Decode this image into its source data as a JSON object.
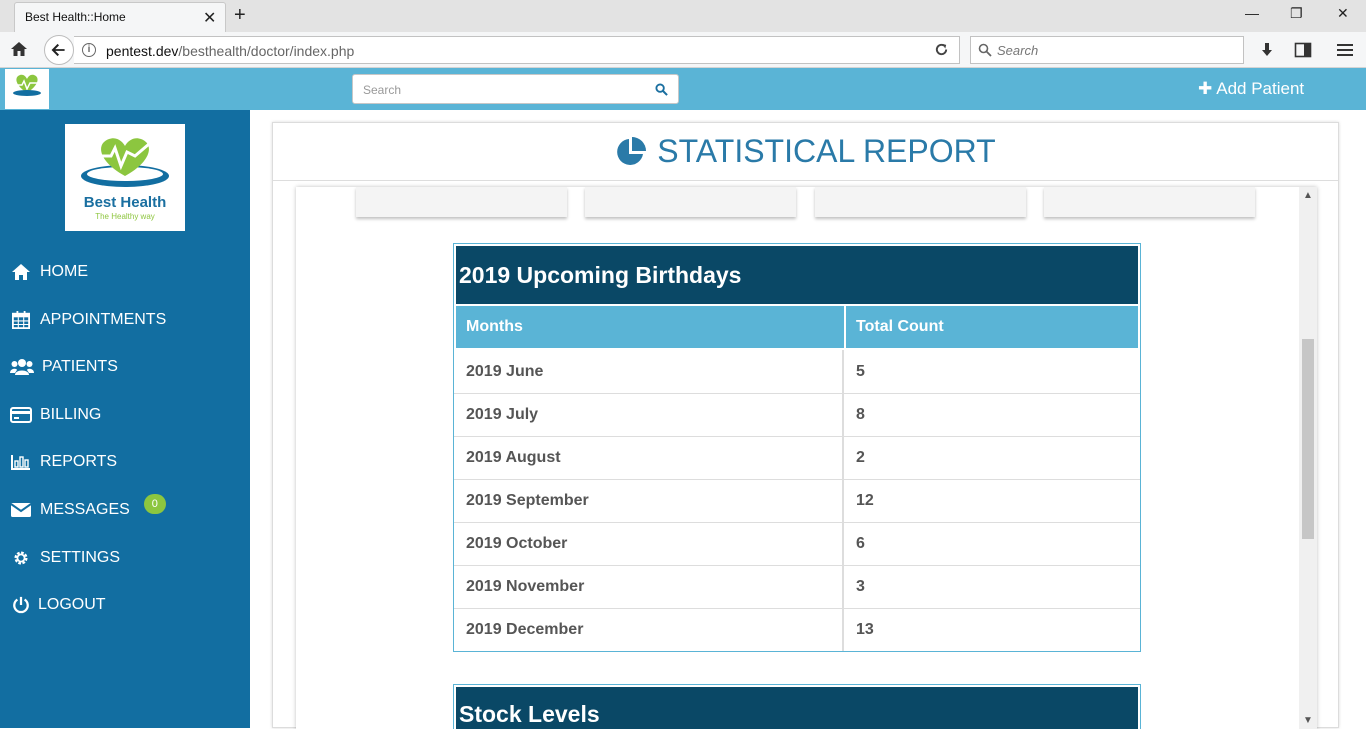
{
  "browser": {
    "tab_title": "Best Health::Home",
    "tab_close": "✕",
    "new_tab": "+",
    "url_host": "pentest.dev",
    "url_path": "/besthealth/doctor/index.php",
    "search_placeholder": "Search",
    "minimize": "—",
    "restore": "❐",
    "close": "✕"
  },
  "header": {
    "search_placeholder": "Search",
    "add_patient_label": "Add Patient"
  },
  "brand": {
    "name": "Best Health",
    "tagline": "The Healthy way"
  },
  "sidebar": {
    "items": [
      {
        "label": "HOME",
        "icon": "home-icon"
      },
      {
        "label": "APPOINTMENTS",
        "icon": "calendar-icon"
      },
      {
        "label": "PATIENTS",
        "icon": "users-icon"
      },
      {
        "label": "BILLING",
        "icon": "credit-card-icon"
      },
      {
        "label": "REPORTS",
        "icon": "bar-chart-icon"
      },
      {
        "label": "MESSAGES",
        "icon": "envelope-icon",
        "badge": "0"
      },
      {
        "label": "SETTINGS",
        "icon": "gear-icon"
      },
      {
        "label": "LOGOUT",
        "icon": "power-icon"
      }
    ]
  },
  "report": {
    "title": "STATISTICAL REPORT",
    "birthdays": {
      "title": "2019 Upcoming Birthdays",
      "col_months": "Months",
      "col_count": "Total Count",
      "rows": [
        {
          "month": "2019 June",
          "count": "5"
        },
        {
          "month": "2019 July",
          "count": "8"
        },
        {
          "month": "2019 August",
          "count": "2"
        },
        {
          "month": "2019 September",
          "count": "12"
        },
        {
          "month": "2019 October",
          "count": "6"
        },
        {
          "month": "2019 November",
          "count": "3"
        },
        {
          "month": "2019 December",
          "count": "13"
        }
      ]
    },
    "stock_title": "Stock Levels"
  },
  "colors": {
    "sidebar": "#126ea1",
    "header": "#5ab4d6",
    "table_title": "#0a4866",
    "badge": "#8cc63f",
    "title": "#2a7aa8"
  }
}
